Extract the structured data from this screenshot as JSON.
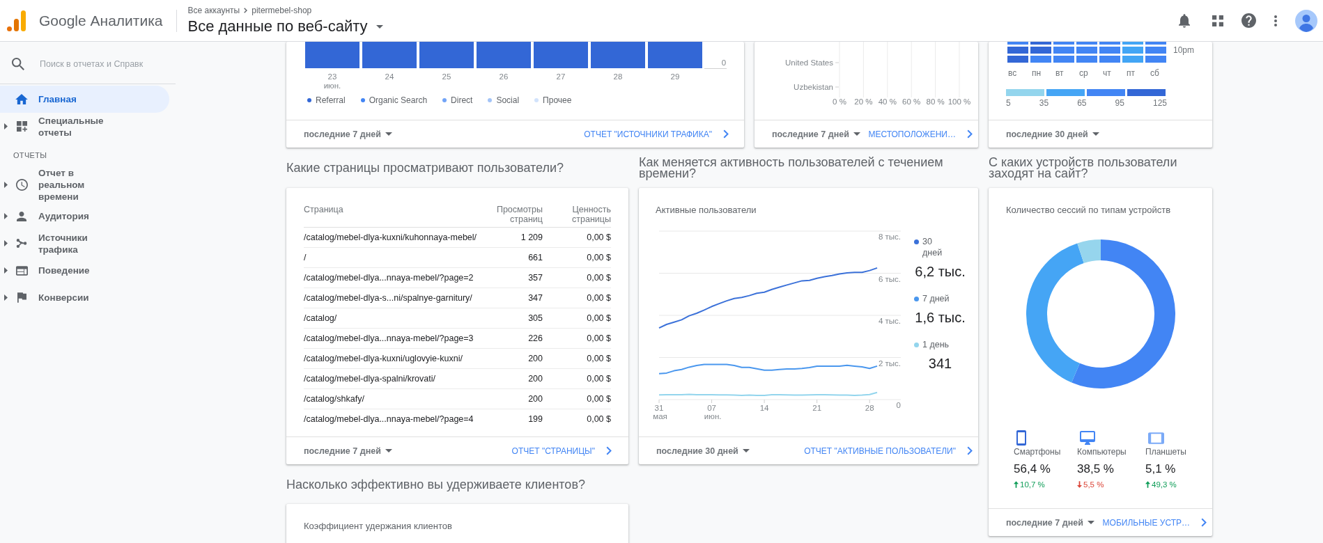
{
  "header": {
    "product": "Google Аналитика",
    "breadcrumb": [
      "Все аккаунты",
      "pitermebel-shop"
    ],
    "view": "Все данные по веб-сайту"
  },
  "sidebar": {
    "search": {
      "placeholder": "Поиск в отчетах и Справк"
    },
    "items": [
      {
        "kind": "item",
        "label": "Главная",
        "selected": true,
        "expandable": false
      },
      {
        "kind": "item",
        "label": "Специальные отчеты",
        "selected": false,
        "expandable": true
      },
      {
        "kind": "heading",
        "label": "ОТЧЕТЫ"
      },
      {
        "kind": "item",
        "label": "Отчет в реальном времени",
        "selected": false,
        "expandable": true
      },
      {
        "kind": "item",
        "label": "Аудитория",
        "selected": false,
        "expandable": true
      },
      {
        "kind": "item",
        "label": "Источники трафика",
        "selected": false,
        "expandable": true
      },
      {
        "kind": "item",
        "label": "Поведение",
        "selected": false,
        "expandable": true
      },
      {
        "kind": "item",
        "label": "Конверсии",
        "selected": false,
        "expandable": true
      }
    ]
  },
  "traffic_sources": {
    "x_labels": [
      {
        "day": "23",
        "month": "июн."
      },
      {
        "day": "24"
      },
      {
        "day": "25"
      },
      {
        "day": "26"
      },
      {
        "day": "27"
      },
      {
        "day": "28"
      },
      {
        "day": "29"
      }
    ],
    "y_tick": "0",
    "legend": [
      {
        "label": "Referral",
        "color": "#3367d6"
      },
      {
        "label": "Organic Search",
        "color": "#4285f4"
      },
      {
        "label": "Direct",
        "color": "#72a4f7"
      },
      {
        "label": "Social",
        "color": "#a3c4f7"
      },
      {
        "label": "Прочее",
        "color": "#d2e3fc"
      }
    ],
    "footer": {
      "period": "последние 7 дней",
      "link": "ОТЧЕТ \"ИСТОЧНИКИ ТРАФИКА\""
    }
  },
  "locations": {
    "rows": [
      "United States",
      "Uzbekistan"
    ],
    "ticks": [
      "0 %",
      "20 %",
      "40 %",
      "60 %",
      "80 %",
      "100 %"
    ],
    "footer": {
      "period": "последние 7 дней",
      "link": "МЕСТОПОЛОЖЕНИ…"
    }
  },
  "activity_heatmap": {
    "rows": [
      {
        "cells": [
          {
            "color": "#4285f4"
          },
          {
            "color": "#3367d6"
          },
          {
            "color": "#4285f4"
          },
          {
            "color": "#4285f4"
          },
          {
            "color": "#4285f4"
          },
          {
            "color": "#42a5f5"
          },
          {
            "color": "#4285f4"
          }
        ]
      },
      {
        "label": "10pm",
        "cells": [
          {
            "color": "#3367d6"
          },
          {
            "color": "#3367d6"
          },
          {
            "color": "#4285f4"
          },
          {
            "color": "#4285f4"
          },
          {
            "color": "#4285f4"
          },
          {
            "color": "#42a5f5"
          },
          {
            "color": "#4285f4"
          }
        ]
      },
      {
        "cells": [
          {
            "color": "#3367d6"
          },
          {
            "color": "#4285f4"
          },
          {
            "color": "#4285f4"
          },
          {
            "color": "#4285f4"
          },
          {
            "color": "#4285f4"
          },
          {
            "color": "#42a5f5"
          },
          {
            "color": "#4285f4"
          }
        ]
      }
    ],
    "days": [
      "вс",
      "пн",
      "вт",
      "ср",
      "чт",
      "пт",
      "сб"
    ],
    "scale": [
      {
        "color": "#93d5ed"
      },
      {
        "color": "#45a5f5"
      },
      {
        "color": "#4285f4"
      },
      {
        "color": "#3367d6"
      }
    ],
    "scale_labels": [
      "5",
      "35",
      "65",
      "95",
      "125"
    ],
    "footer": {
      "period": "последние 30 дней"
    }
  },
  "pages": {
    "title": "Какие страницы просматривают пользователи?",
    "columns": [
      "Страница",
      "Просмотры страниц",
      "Ценность страницы"
    ],
    "rows": [
      {
        "page": "/catalog/mebel-dlya-kuxni/kuhonnaya-mebel/",
        "views": "1 209",
        "value": "0,00 $"
      },
      {
        "page": "/",
        "views": "661",
        "value": "0,00 $"
      },
      {
        "page": "/catalog/mebel-dlya...nnaya-mebel/?page=2",
        "views": "357",
        "value": "0,00 $"
      },
      {
        "page": "/catalog/mebel-dlya-s...ni/spalnye-garnitury/",
        "views": "347",
        "value": "0,00 $"
      },
      {
        "page": "/catalog/",
        "views": "305",
        "value": "0,00 $"
      },
      {
        "page": "/catalog/mebel-dlya...nnaya-mebel/?page=3",
        "views": "226",
        "value": "0,00 $"
      },
      {
        "page": "/catalog/mebel-dlya-kuxni/uglovyie-kuxni/",
        "views": "200",
        "value": "0,00 $"
      },
      {
        "page": "/catalog/mebel-dlya-spalni/krovati/",
        "views": "200",
        "value": "0,00 $"
      },
      {
        "page": "/catalog/shkafy/",
        "views": "200",
        "value": "0,00 $"
      },
      {
        "page": "/catalog/mebel-dlya...nnaya-mebel/?page=4",
        "views": "199",
        "value": "0,00 $"
      }
    ],
    "footer": {
      "period": "последние 7 дней",
      "link": "ОТЧЕТ \"СТРАНИЦЫ\""
    }
  },
  "active_users": {
    "title": "Как меняется активность пользователей с течением времени?",
    "chart_data": {
      "type": "line",
      "title": "Активные пользователи",
      "categories": [
        "31 мая",
        null,
        null,
        null,
        null,
        null,
        null,
        "07 июн.",
        null,
        null,
        null,
        null,
        null,
        null,
        "14",
        null,
        null,
        null,
        null,
        null,
        null,
        "21",
        null,
        null,
        null,
        null,
        null,
        null,
        "28",
        null
      ],
      "ylim": [
        0,
        8
      ],
      "yticks": [
        {
          "value": 0,
          "label": "0"
        },
        {
          "value": 2,
          "label": "2 тыс."
        },
        {
          "value": 4,
          "label": "4 тыс."
        },
        {
          "value": 6,
          "label": "6 тыс."
        },
        {
          "value": 8,
          "label": "8 тыс."
        }
      ],
      "grid": true,
      "series": [
        {
          "name": "30 дней",
          "color": "#3b71d9",
          "values": [
            3.4,
            3.57,
            3.68,
            3.79,
            3.98,
            4.1,
            4.25,
            4.42,
            4.56,
            4.69,
            4.8,
            4.85,
            4.94,
            5.05,
            5.1,
            5.23,
            5.34,
            5.44,
            5.54,
            5.64,
            5.66,
            5.76,
            5.83,
            5.89,
            5.97,
            6.02,
            6.04,
            6.04,
            6.13,
            6.25
          ]
        },
        {
          "name": "7 дней",
          "color": "#4a97ee",
          "values": [
            1.23,
            1.26,
            1.37,
            1.43,
            1.54,
            1.62,
            1.67,
            1.67,
            1.67,
            1.67,
            1.62,
            1.53,
            1.53,
            1.46,
            1.4,
            1.4,
            1.43,
            1.45,
            1.45,
            1.48,
            1.52,
            1.59,
            1.59,
            1.59,
            1.59,
            1.63,
            1.59,
            1.55,
            1.48,
            1.59
          ]
        },
        {
          "name": "1 день",
          "color": "#93d5ed",
          "values": [
            0.22,
            0.23,
            0.23,
            0.23,
            0.25,
            0.23,
            0.23,
            0.23,
            0.22,
            0.22,
            0.21,
            0.2,
            0.21,
            0.2,
            0.2,
            0.23,
            0.23,
            0.22,
            0.21,
            0.21,
            0.22,
            0.23,
            0.23,
            0.22,
            0.21,
            0.21,
            0.2,
            0.21,
            0.24,
            0.34
          ]
        }
      ]
    },
    "totals": [
      "6,2 тыс.",
      "1,6 тыс.",
      "341"
    ],
    "footer": {
      "period": "последние 30 дней",
      "link": "ОТЧЕТ \"АКТИВНЫЕ ПОЛЬЗОВАТЕЛИ\""
    }
  },
  "devices": {
    "title": "С каких устройств пользователи заходят на сайт?",
    "chart_data": {
      "type": "donut",
      "title": "Количество сессий по типам устройств",
      "categories": [
        "Смартфоны",
        "Компьютеры",
        "Планшеты"
      ],
      "values": [
        56.4,
        38.5,
        5.1
      ]
    },
    "items": [
      {
        "share": "56,4 %",
        "change": "10,7 %",
        "rising": true,
        "color": "#3367d6"
      },
      {
        "share": "38,5 %",
        "change": "5,5 %",
        "rising": false,
        "color": "#4285f4"
      },
      {
        "share": "5,1 %",
        "change": "49,3 %",
        "rising": true,
        "color": "#7baaf7"
      }
    ],
    "footer": {
      "period": "последние 7 дней",
      "link": "МОБИЛЬНЫЕ УСТР…"
    }
  },
  "retention": {
    "title": "Насколько эффективно вы удерживаете клиентов?",
    "card_title": "Коэффициент удержания клиентов"
  }
}
